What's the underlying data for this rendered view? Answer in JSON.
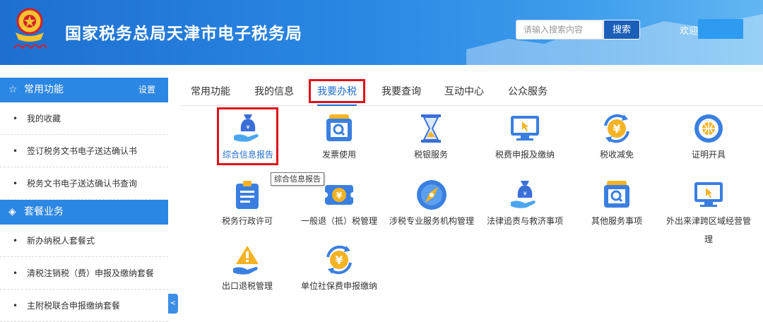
{
  "header": {
    "site_title": "国家税务总局天津市电子税务局",
    "search_placeholder": "请输入搜索内容",
    "search_button": "搜索",
    "welcome": "欢迎"
  },
  "sidebar": {
    "sections": [
      {
        "title": "常用功能",
        "icon": "star-icon",
        "action": "设置",
        "items": [
          "我的收藏",
          "签订税务文书电子送达确认书",
          "税务文书电子送达确认书查询"
        ]
      },
      {
        "title": "套餐业务",
        "icon": "layers-icon",
        "items": [
          "新办纳税人套餐式",
          "清税注销税（费）申报及缴纳套餐",
          "主附税联合申报缴纳套餐"
        ]
      }
    ]
  },
  "tabs": [
    "常用功能",
    "我的信息",
    "我要办税",
    "我要查询",
    "互动中心",
    "公众服务"
  ],
  "active_tab": "我要办税",
  "services": [
    {
      "label": "综合信息报告",
      "icon": "money-bag-hand-icon"
    },
    {
      "label": "发票使用",
      "icon": "invoice-search-icon"
    },
    {
      "label": "税银服务",
      "icon": "hourglass-icon"
    },
    {
      "label": "税费申报及缴纳",
      "icon": "monitor-cursor-icon"
    },
    {
      "label": "税收减免",
      "icon": "yuan-cycle-icon"
    },
    {
      "label": "证明开具",
      "icon": "globe-icon"
    },
    {
      "label": "税务行政许可",
      "icon": "clipboard-icon"
    },
    {
      "label": "一般退（抵）税管理",
      "icon": "yuan-ticket-icon"
    },
    {
      "label": "涉税专业服务机构管理",
      "icon": "compass-icon"
    },
    {
      "label": "法律追责与救济事项",
      "icon": "money-bag-hand-icon"
    },
    {
      "label": "其他服务事项",
      "icon": "invoice-search-icon"
    },
    {
      "label": "外出来津跨区域经营管",
      "label_line2": "理",
      "icon": "monitor-cursor-icon"
    },
    {
      "label": "出口退税管理",
      "icon": "warning-hand-icon"
    },
    {
      "label": "单位社保费申报缴纳",
      "icon": "yuan-cycle-icon"
    }
  ],
  "tooltip": "综合信息报告",
  "colors": {
    "header_blue": "#2a86e2",
    "accent_blue": "#1f6fd1",
    "highlight_red": "#e0101a",
    "icon_orange": "#f5a623"
  }
}
